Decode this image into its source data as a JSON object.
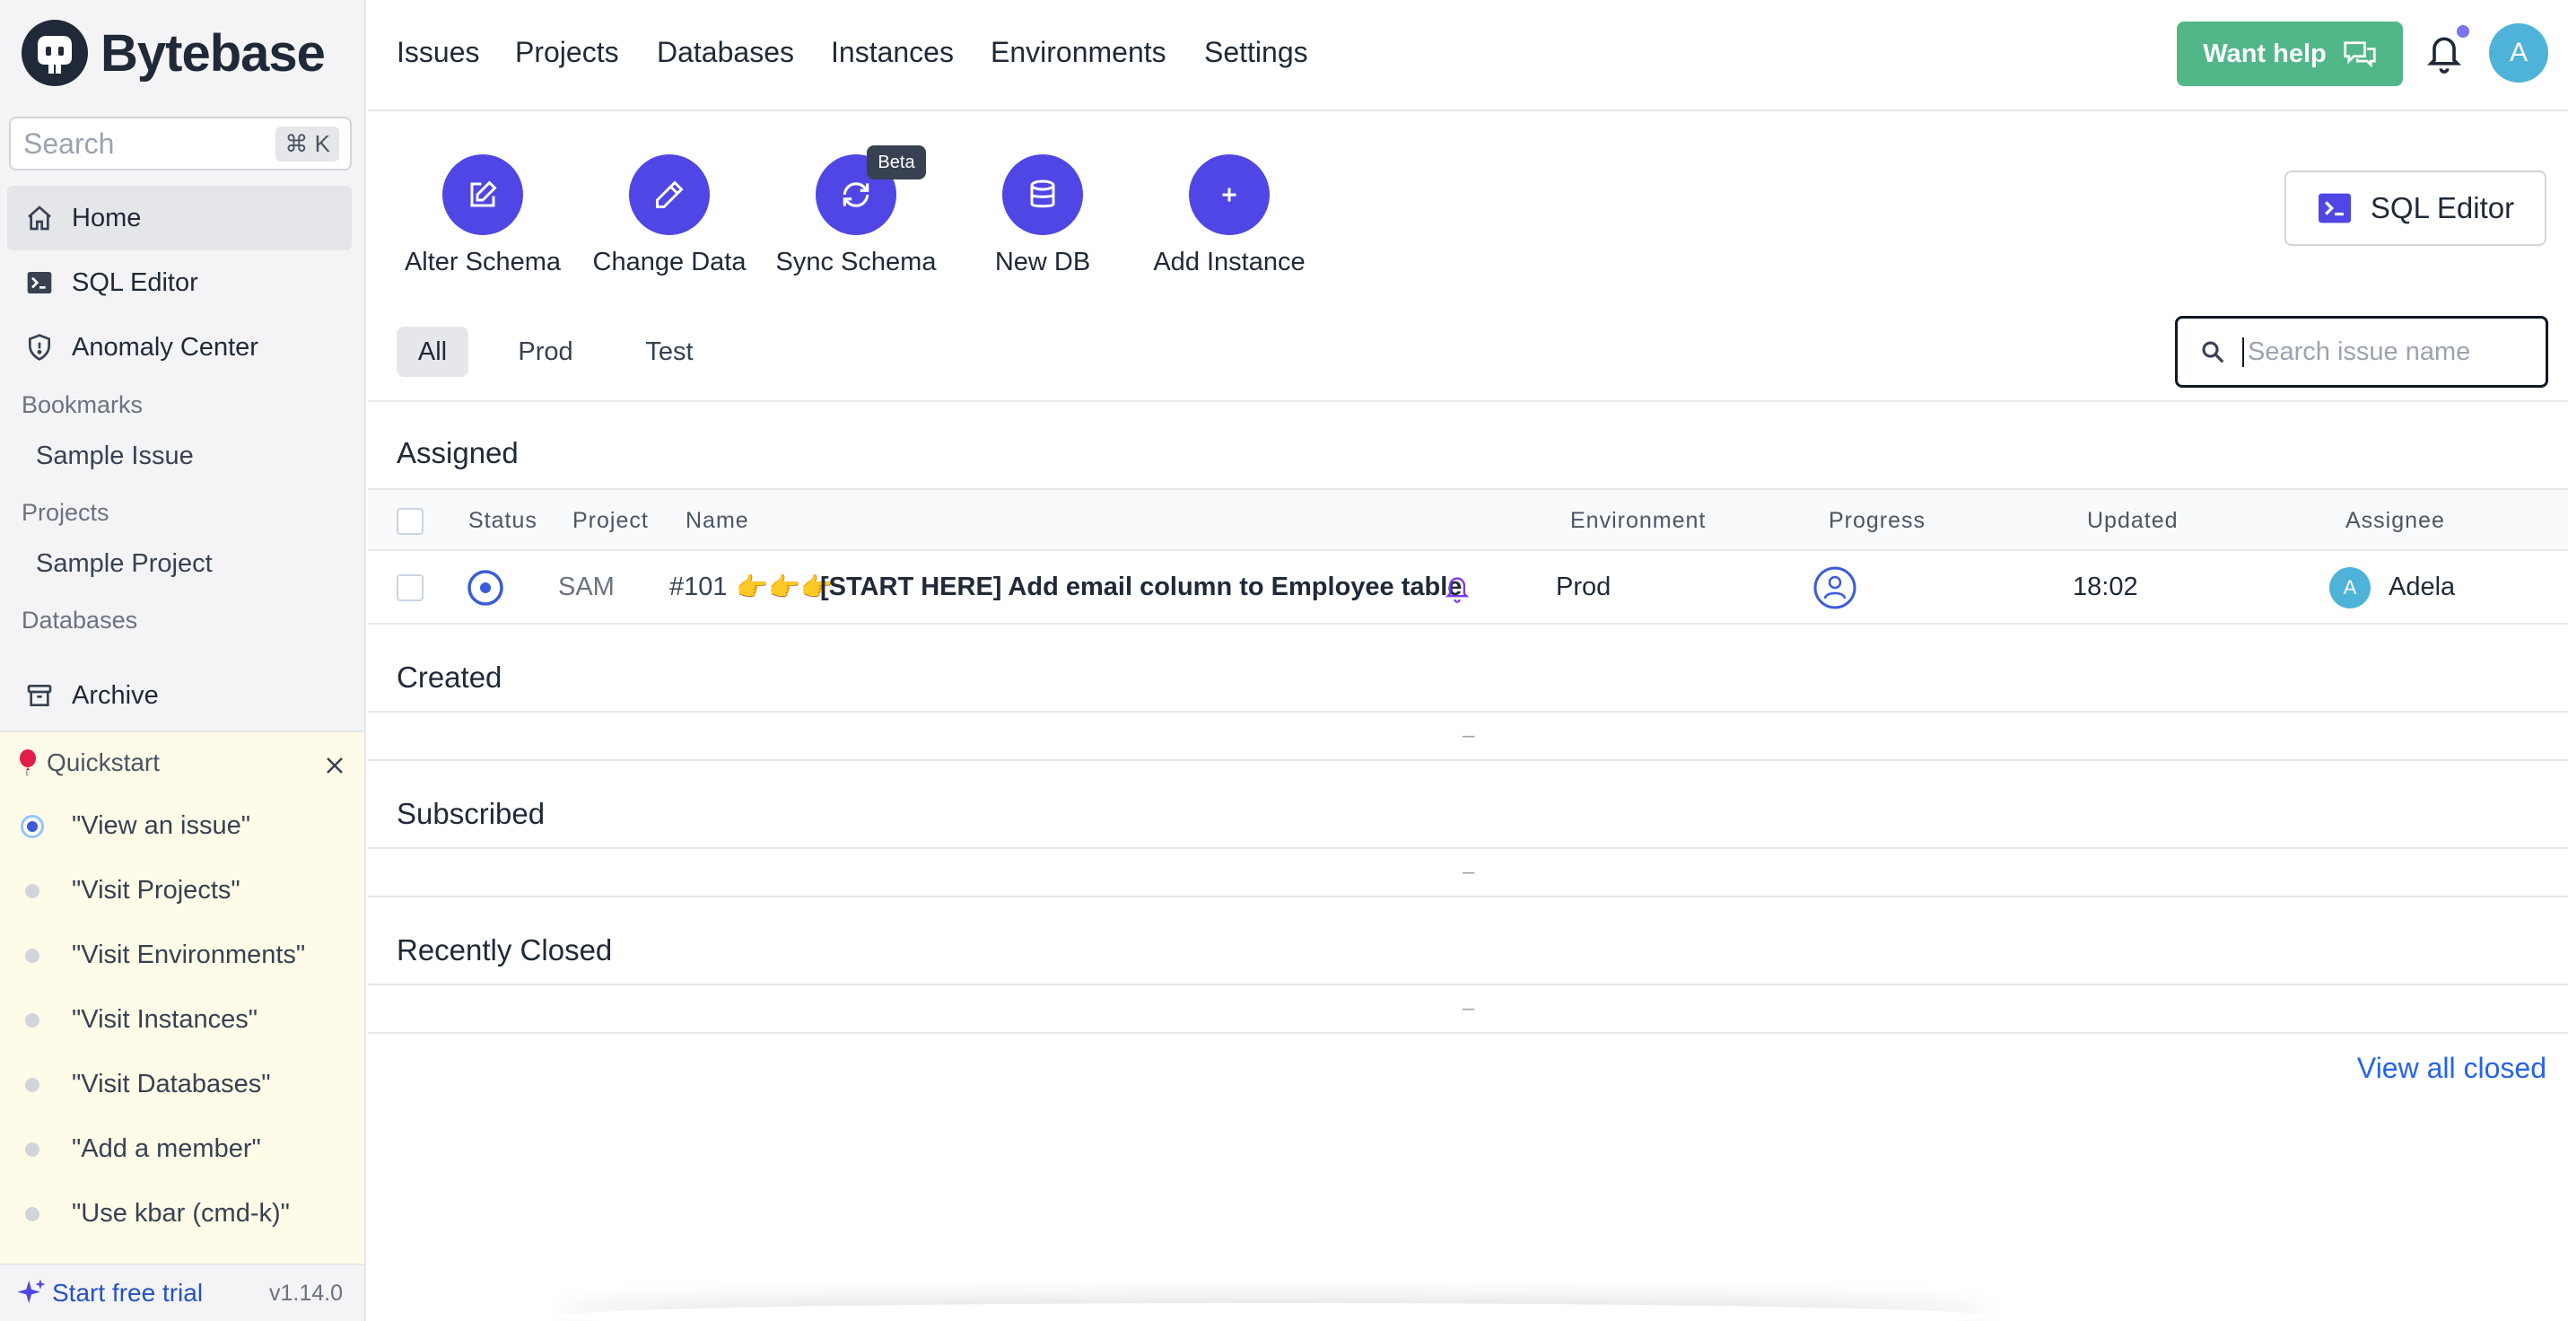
{
  "app": {
    "name": "Bytebase"
  },
  "sidebar": {
    "search_placeholder": "Search",
    "search_shortcut": "⌘ K",
    "nav": [
      {
        "label": "Home",
        "icon": "home-icon",
        "active": true
      },
      {
        "label": "SQL Editor",
        "icon": "terminal-icon"
      },
      {
        "label": "Anomaly Center",
        "icon": "shield-icon"
      }
    ],
    "bookmarks_heading": "Bookmarks",
    "bookmarks": [
      "Sample Issue"
    ],
    "projects_heading": "Projects",
    "projects": [
      "Sample Project"
    ],
    "databases_heading": "Databases",
    "archive_label": "Archive",
    "quickstart": {
      "title": "Quickstart",
      "items": [
        "\"View an issue\"",
        "\"Visit Projects\"",
        "\"Visit Environments\"",
        "\"Visit Instances\"",
        "\"Visit Databases\"",
        "\"Add a member\"",
        "\"Use kbar (cmd-k)\""
      ]
    },
    "footer": {
      "trial": "Start free trial",
      "version": "v1.14.0"
    }
  },
  "topnav": {
    "items": [
      "Issues",
      "Projects",
      "Databases",
      "Instances",
      "Environments",
      "Settings"
    ],
    "want_help": "Want help",
    "avatar_initial": "A"
  },
  "quick_actions": [
    {
      "label": "Alter Schema",
      "icon": "edit-square-icon"
    },
    {
      "label": "Change Data",
      "icon": "pencil-icon"
    },
    {
      "label": "Sync Schema",
      "icon": "sync-icon",
      "badge": "Beta"
    },
    {
      "label": "New DB",
      "icon": "database-icon"
    },
    {
      "label": "Add Instance",
      "icon": "plus-icon"
    }
  ],
  "sql_editor_button": "SQL Editor",
  "filters": {
    "tabs": [
      "All",
      "Prod",
      "Test"
    ],
    "active": "All"
  },
  "issue_search_placeholder": "Search issue name",
  "sections": {
    "assigned": "Assigned",
    "created": "Created",
    "subscribed": "Subscribed",
    "recently_closed": "Recently Closed",
    "empty_marker": "–"
  },
  "table": {
    "columns": [
      "Status",
      "Project",
      "Name",
      "Environment",
      "Progress",
      "Updated",
      "Assignee"
    ],
    "rows": [
      {
        "project": "SAM",
        "id": "#101",
        "emoji": "👉👉👉",
        "name": "[START HERE] Add email column to Employee table",
        "environment": "Prod",
        "updated": "18:02",
        "assignee_initial": "A",
        "assignee": "Adela"
      }
    ]
  },
  "view_all_closed": "View all closed",
  "colors": {
    "accent": "#4f46e5",
    "help_green": "#52b788",
    "link": "#2563eb",
    "quickstart_bg": "#fefce8"
  }
}
